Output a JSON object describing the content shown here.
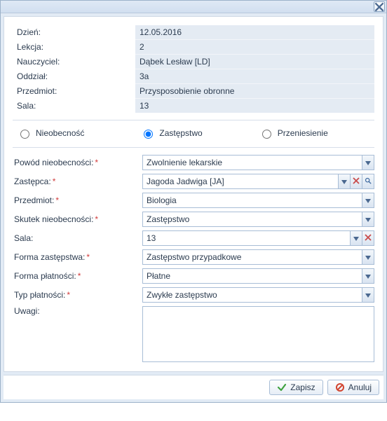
{
  "info": {
    "dzien_label": "Dzień:",
    "dzien_value": "12.05.2016",
    "lekcja_label": "Lekcja:",
    "lekcja_value": "2",
    "nauczyciel_label": "Nauczyciel:",
    "nauczyciel_value": "Dąbek Lesław [LD]",
    "oddzial_label": "Oddział:",
    "oddzial_value": "3a",
    "przedmiot_label": "Przedmiot:",
    "przedmiot_value": "Przysposobienie obronne",
    "sala_label": "Sala:",
    "sala_value": "13"
  },
  "radios": {
    "nieobecnosc": "Nieobecność",
    "zastepstwo": "Zastępstwo",
    "przeniesienie": "Przeniesienie",
    "selected": "zastepstwo"
  },
  "form": {
    "powod_label": "Powód nieobecności:",
    "powod_value": "Zwolnienie lekarskie",
    "zastepca_label": "Zastępca:",
    "zastepca_value": "Jagoda Jadwiga [JA]",
    "przedmiot_label": "Przedmiot:",
    "przedmiot_value": "Biologia",
    "skutek_label": "Skutek nieobecności:",
    "skutek_value": "Zastępstwo",
    "sala_label": "Sala:",
    "sala_value": "13",
    "forma_zast_label": "Forma zastępstwa:",
    "forma_zast_value": "Zastępstwo przypadkowe",
    "forma_plat_label": "Forma płatności:",
    "forma_plat_value": "Płatne",
    "typ_plat_label": "Typ płatności:",
    "typ_plat_value": "Zwykłe zastępstwo",
    "uwagi_label": "Uwagi:",
    "uwagi_value": ""
  },
  "buttons": {
    "save": "Zapisz",
    "cancel": "Anuluj"
  }
}
